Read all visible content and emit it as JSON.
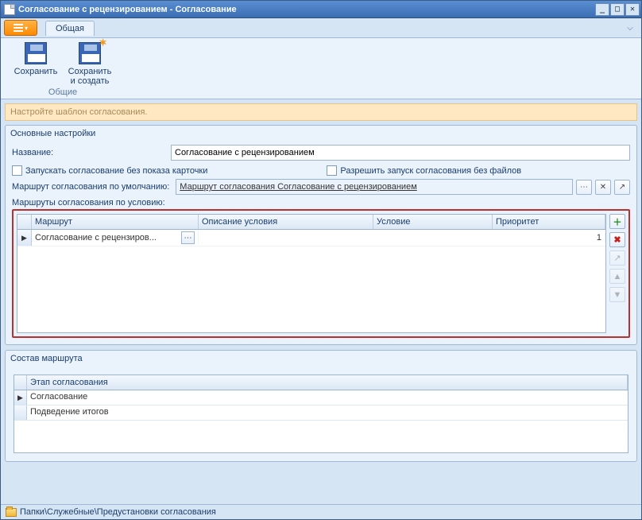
{
  "titlebar": {
    "title": "Согласование с рецензированием - Согласование"
  },
  "ribbon": {
    "tab_label": "Общая",
    "group_label": "Общие",
    "save_label": "Сохранить",
    "save_create_label": "Сохранить и создать"
  },
  "hint": "Настройте шаблон согласования.",
  "panel_main": {
    "title": "Основные настройки",
    "name_label": "Название:",
    "name_value": "Согласование с рецензированием",
    "chk_launch_without_card": "Запускать согласование без показа карточки",
    "chk_allow_without_files": "Разрешить запуск согласования без файлов",
    "default_route_label": "Маршрут согласования по умолчанию:",
    "default_route_value": "Маршрут согласования Согласование с рецензированием",
    "routes_by_condition_label": "Маршруты согласования по условию:"
  },
  "grid": {
    "headers": {
      "route": "Маршрут",
      "condition_desc": "Описание условия",
      "condition": "Условие",
      "priority": "Приоритет"
    },
    "rows": [
      {
        "route": "Согласование с рецензиров...",
        "condition_desc": "",
        "condition": "",
        "priority": "1"
      }
    ]
  },
  "panel_route": {
    "title": "Состав маршрута",
    "stage_header": "Этап согласования",
    "rows": [
      "Согласование",
      "Подведение итогов"
    ]
  },
  "statusbar": {
    "path": "Папки\\Служебные\\Предустановки согласования"
  }
}
